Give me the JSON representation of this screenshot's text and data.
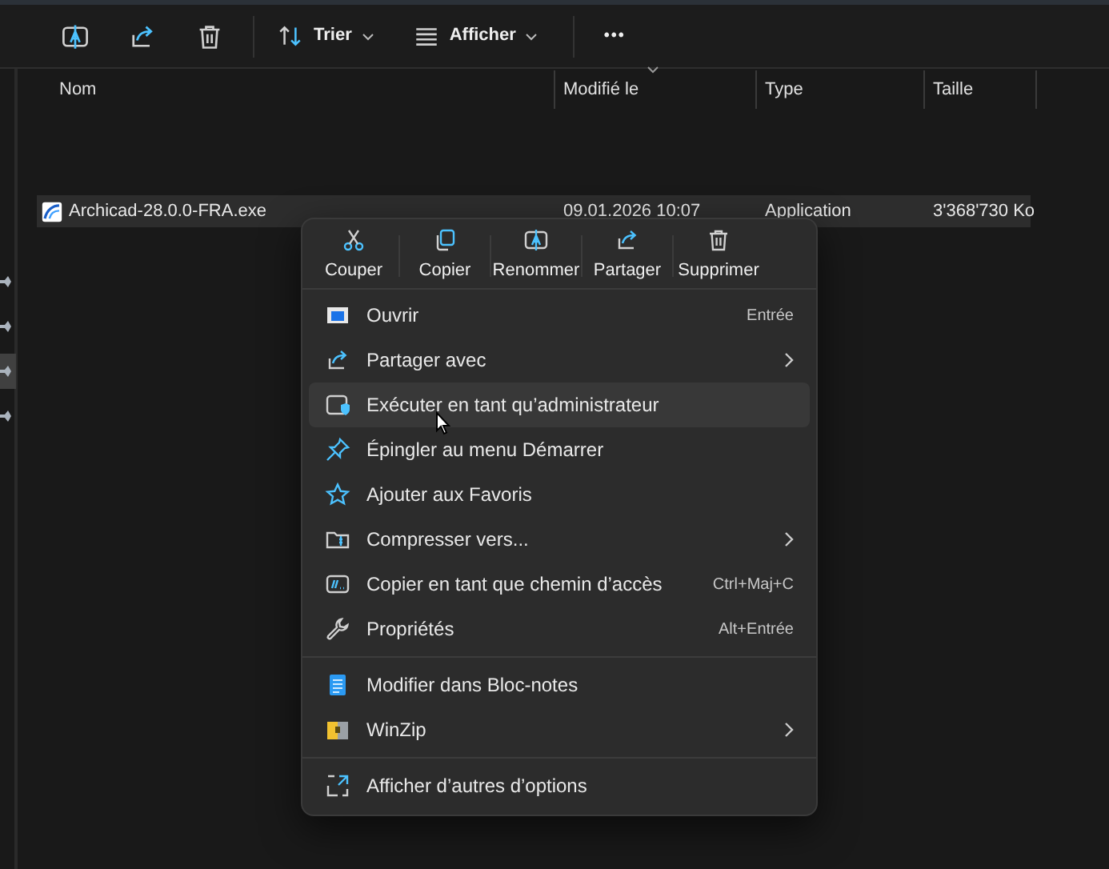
{
  "toolbar": {
    "buttons": [
      {
        "kind": "icon"
      },
      {
        "kind": "icon"
      },
      {
        "kind": "icon"
      },
      {
        "kind": "separator"
      },
      {
        "kind": "dropdown",
        "label": "Trier"
      },
      {
        "kind": "dropdown",
        "label": "Afficher"
      },
      {
        "kind": "separator"
      },
      {
        "kind": "more",
        "label": "•••"
      }
    ]
  },
  "navigation_pane": {
    "pins": [
      {
        "selected": false
      },
      {
        "selected": false
      },
      {
        "selected": true
      },
      {
        "selected": false
      }
    ]
  },
  "file_list": {
    "columns": [
      {
        "label": "Nom",
        "sorted": false
      },
      {
        "label": "Modifié le",
        "sorted": true
      },
      {
        "label": "Type",
        "sorted": false
      },
      {
        "label": "Taille",
        "sorted": false
      }
    ],
    "rows": [
      {
        "name": "Archicad-28.0.0-FRA.exe",
        "modified": "09.01.2026 10:07",
        "type": "Application",
        "size": "3'368'730 Ko",
        "selected": true
      }
    ]
  },
  "context_menu": {
    "actions": [
      {
        "label": "Couper"
      },
      {
        "label": "Copier"
      },
      {
        "label": "Renommer"
      },
      {
        "label": "Partager"
      },
      {
        "label": "Supprimer"
      }
    ],
    "sections": [
      {
        "items": [
          {
            "label": "Ouvrir",
            "shortcut": "Entrée",
            "submenu": false,
            "hovered": false
          },
          {
            "label": "Partager avec",
            "submenu": true,
            "hovered": false
          },
          {
            "label": "Exécuter en tant qu’administrateur",
            "submenu": false,
            "hovered": true
          },
          {
            "label": "Épingler au menu Démarrer",
            "submenu": false,
            "hovered": false
          },
          {
            "label": "Ajouter aux Favoris",
            "submenu": false,
            "hovered": false
          },
          {
            "label": "Compresser vers...",
            "submenu": true,
            "hovered": false
          },
          {
            "label": "Copier en tant que chemin d’accès",
            "shortcut": "Ctrl+Maj+C",
            "submenu": false,
            "hovered": false
          },
          {
            "label": "Propriétés",
            "shortcut": "Alt+Entrée",
            "submenu": false,
            "hovered": false
          }
        ]
      },
      {
        "items": [
          {
            "label": "Modifier dans Bloc-notes",
            "submenu": false,
            "hovered": false
          },
          {
            "label": "WinZip",
            "submenu": true,
            "hovered": false
          }
        ]
      },
      {
        "items": [
          {
            "label": "Afficher d’autres d’options",
            "submenu": false,
            "hovered": false
          }
        ]
      }
    ]
  }
}
